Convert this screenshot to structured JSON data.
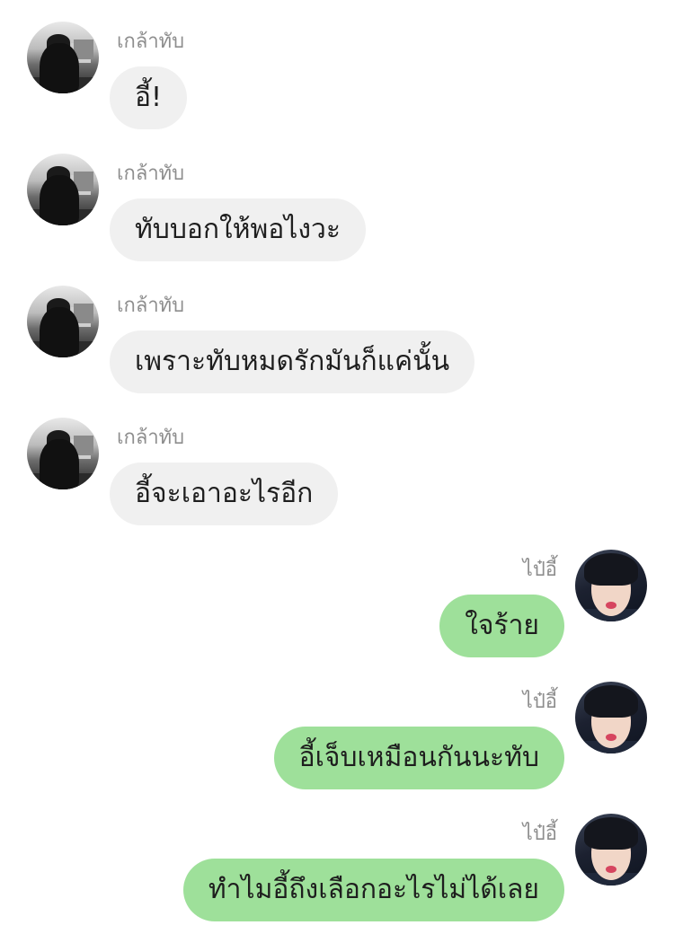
{
  "chat": {
    "messages": [
      {
        "side": "left",
        "sender": "เกล้าทับ",
        "text": "อี้!"
      },
      {
        "side": "left",
        "sender": "เกล้าทับ",
        "text": "ทับบอกให้พอไงวะ"
      },
      {
        "side": "left",
        "sender": "เกล้าทับ",
        "text": "เพราะทับหมดรักมันก็แค่นั้น"
      },
      {
        "side": "left",
        "sender": "เกล้าทับ",
        "text": "อี้จะเอาอะไรอีก"
      },
      {
        "side": "right",
        "sender": "ไป๋อี้",
        "text": "ใจร้าย"
      },
      {
        "side": "right",
        "sender": "ไป๋อี้",
        "text": "อี้เจ็บเหมือนกันนะทับ"
      },
      {
        "side": "right",
        "sender": "ไป๋อี้",
        "text": "ทำไมอี้ถึงเลือกอะไรไม่ได้เลย"
      }
    ]
  },
  "colors": {
    "incoming_bubble": "#f0f0f0",
    "outgoing_bubble": "#9ee09a",
    "sender_name": "#8e8e8e"
  },
  "icons": {
    "incoming_avatar": "avatar-grayscale-street-photo",
    "outgoing_avatar": "avatar-portrait-photo"
  }
}
